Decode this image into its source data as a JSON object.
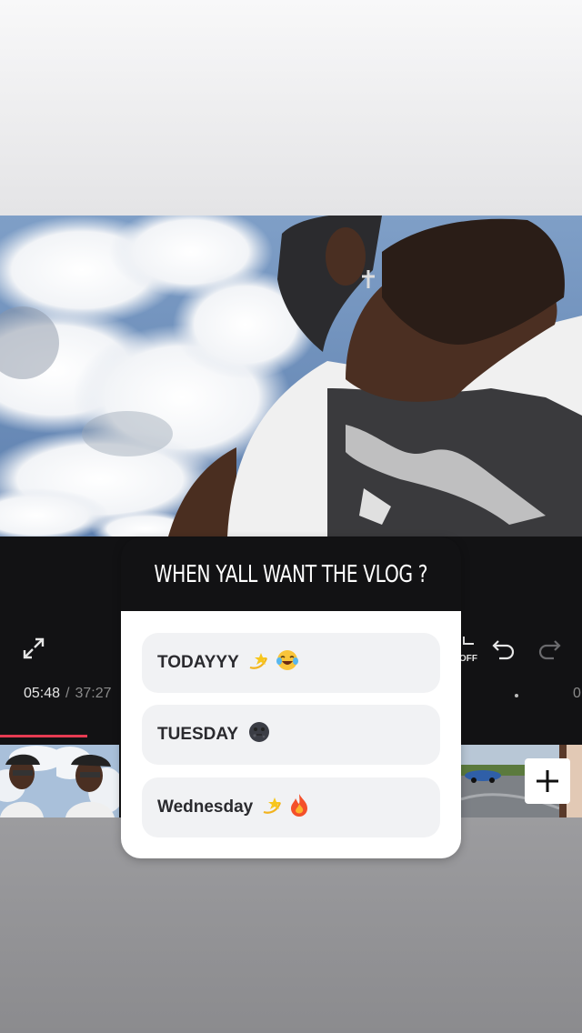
{
  "poll": {
    "question": "WHEN YALL WANT THE VLOG ?",
    "options": [
      {
        "label": "TODAYYY",
        "emojis": [
          "dizzy-star-emoji",
          "tears-of-joy-emoji"
        ]
      },
      {
        "label": "TUESDAY",
        "emojis": [
          "new-moon-face-emoji"
        ]
      },
      {
        "label": "Wednesday",
        "emojis": [
          "dizzy-star-emoji",
          "fire-emoji"
        ]
      }
    ]
  },
  "editor": {
    "current_time": "05:48",
    "separator": "/",
    "total_time": "37:27",
    "right_time_fragment": "0",
    "off_label": "OFF",
    "progress_fraction": 0.15
  },
  "icons": {
    "fullscreen": "fullscreen-icon",
    "undo": "undo-icon",
    "redo": "redo-icon",
    "add": "add-clip-icon"
  },
  "colors": {
    "accent": "#e63b52",
    "editor_bg": "#121214",
    "poll_header_bg": "#121214",
    "poll_option_bg": "#f1f2f4"
  }
}
